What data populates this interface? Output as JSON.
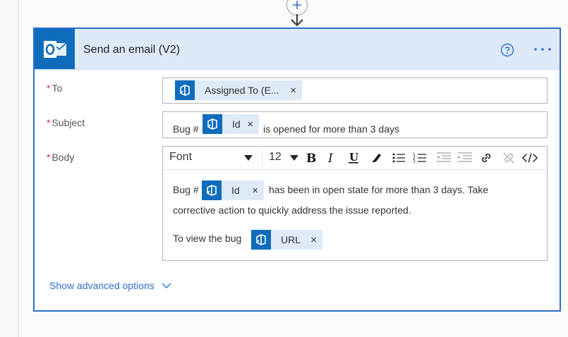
{
  "card": {
    "title": "Send an email (V2)",
    "help_icon": "question-circle-icon",
    "more_icon": "ellipsis-icon",
    "brand_color": "#0f6cbd",
    "header_bg": "#dde9f7"
  },
  "fields": {
    "to": {
      "label": "To",
      "required_marker": "*",
      "token": {
        "label": "Assigned To (E...",
        "remove": "×"
      }
    },
    "subject": {
      "label": "Subject",
      "required_marker": "*",
      "prefix": "Bug #",
      "token": {
        "label": "Id",
        "remove": "×"
      },
      "suffix": "is opened for more than 3 days"
    },
    "body": {
      "label": "Body",
      "required_marker": "*",
      "toolbar": {
        "font": "Font",
        "size": "12",
        "buttons": [
          "bold-icon",
          "italic-icon",
          "underline-icon",
          "highlight-pen-icon",
          "bulleted-list-icon",
          "numbered-list-icon",
          "decrease-indent-icon",
          "increase-indent-icon",
          "link-icon",
          "unlink-icon",
          "code-view-icon"
        ]
      },
      "line1_prefix": "Bug #",
      "line1_token": {
        "label": "Id",
        "remove": "×"
      },
      "line1_suffix": "has been in open state for more than 3 days. Take",
      "line2": "corrective action to quickly address the issue reported.",
      "line3_prefix": "To view the bug",
      "line3_token": {
        "label": "URL",
        "remove": "×"
      }
    }
  },
  "advanced": {
    "label": "Show advanced options",
    "icon": "chevron-down-icon"
  },
  "connector": {
    "add_icon": "plus-circle-icon",
    "arrow_icon": "arrow-down-icon"
  }
}
